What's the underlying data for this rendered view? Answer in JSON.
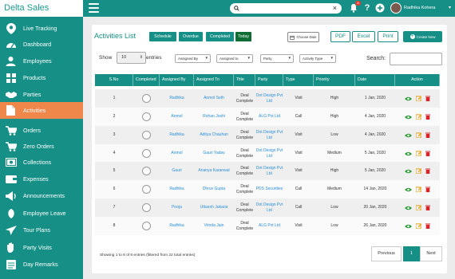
{
  "app": {
    "brand": "Delta Sales"
  },
  "topbar": {
    "search_value": "",
    "notification_count": "8",
    "user_name": "Radhika Kohera"
  },
  "sidebar": {
    "items": [
      {
        "label": "Live Tracking",
        "icon": "location-pin-icon"
      },
      {
        "label": "Dashboard",
        "icon": "speedometer-icon"
      },
      {
        "label": "Employees",
        "icon": "user-icon"
      },
      {
        "label": "Products",
        "icon": "grid-icon"
      },
      {
        "label": "Parties",
        "icon": "handshake-icon"
      },
      {
        "label": "Activities",
        "icon": "document-icon",
        "active": true
      },
      {
        "label": "Orders",
        "icon": "cart-icon"
      },
      {
        "label": "Zero Orders",
        "icon": "cart-zero-icon"
      },
      {
        "label": "Collections",
        "icon": "money-icon"
      },
      {
        "label": "Expenses",
        "icon": "wallet-icon"
      },
      {
        "label": "Announcements",
        "icon": "megaphone-icon"
      },
      {
        "label": "Employee Leave",
        "icon": "leave-icon"
      },
      {
        "label": "Tour Plans",
        "icon": "plane-icon"
      },
      {
        "label": "Party Visits",
        "icon": "hand-icon"
      },
      {
        "label": "Day Remarks",
        "icon": "notes-icon"
      }
    ]
  },
  "page": {
    "title": "Activities List",
    "tabs": [
      "Schedule",
      "Overdue",
      "Completed",
      "Today"
    ],
    "choose_date": "Choose Date",
    "export": [
      "PDF",
      "Excel",
      "Print"
    ],
    "create_label": "Create New",
    "show_label": "Show",
    "show_value": "10",
    "entries_label": "entries",
    "filters": [
      "Assigned By",
      "Assigned to",
      "Party",
      "Activity Type"
    ],
    "search_label": "Search:",
    "search_value": ""
  },
  "table": {
    "columns": [
      "S.No",
      "Completed",
      "Assigned By",
      "Assigned To",
      "Title",
      "Party",
      "Type",
      "Priority",
      "Date",
      "Action"
    ],
    "rows": [
      {
        "sno": "1",
        "by": "Radhika",
        "to": "Anmol Seth",
        "title": "Deal Complete",
        "party": "Dot Design Pvt Ltd",
        "type": "Visit",
        "priority": "High",
        "date": "1 Jan, 2020"
      },
      {
        "sno": "2",
        "by": "Anmol",
        "to": "Rohan Joshi",
        "title": "Deal Complete",
        "party": "ALG Pvt Ltd",
        "type": "Call",
        "priority": "High",
        "date": "4 Jan, 2020"
      },
      {
        "sno": "3",
        "by": "Radhika",
        "to": "Aditya Chauhan",
        "title": "Deal Complete",
        "party": "Dot Design Pvt Ltd",
        "type": "Visit",
        "priority": "Low",
        "date": "4 Jan, 2020"
      },
      {
        "sno": "4",
        "by": "Anmol",
        "to": "Gauri Yadav",
        "title": "Deal Complete",
        "party": "Dot Design Pvt Ltd",
        "type": "Visit",
        "priority": "Medium",
        "date": "5 Jan, 2020"
      },
      {
        "sno": "5",
        "by": "Gauri",
        "to": "Ananya Karanwal",
        "title": "Deal Complete",
        "party": "Dot Design Pvt Ltd",
        "type": "Visit",
        "priority": "High",
        "date": "5 Jan, 2020"
      },
      {
        "sno": "6",
        "by": "Radhika",
        "to": "Dhruv Gupta",
        "title": "Deal Complete",
        "party": "PDS Securities",
        "type": "Call",
        "priority": "Medium",
        "date": "14 Jan, 2020"
      },
      {
        "sno": "7",
        "by": "Pooja",
        "to": "Utkarsh Jukaria",
        "title": "Deal Complete",
        "party": "Dot Design Pvt Ltd",
        "type": "Call",
        "priority": "Low",
        "date": "20 Jan, 2020"
      },
      {
        "sno": "8",
        "by": "Radhika",
        "to": "Vrinda Jain",
        "title": "Deal Complete",
        "party": "ALG Pvt Ltd",
        "type": "Visit",
        "priority": "Low",
        "date": "26 Jan, 2020"
      }
    ]
  },
  "footer": {
    "info": "Showing 1 to 8 of 8 entries (filtered from 22 total entries)",
    "previous": "Previous",
    "current_page": "1",
    "next": "Next"
  },
  "colors": {
    "primary": "#168f86",
    "active": "#f0874a",
    "dark_tab": "#0e6e33",
    "link": "#2a8fd8",
    "view": "#2e9c3a",
    "edit": "#e8a317",
    "delete": "#d9262b"
  }
}
